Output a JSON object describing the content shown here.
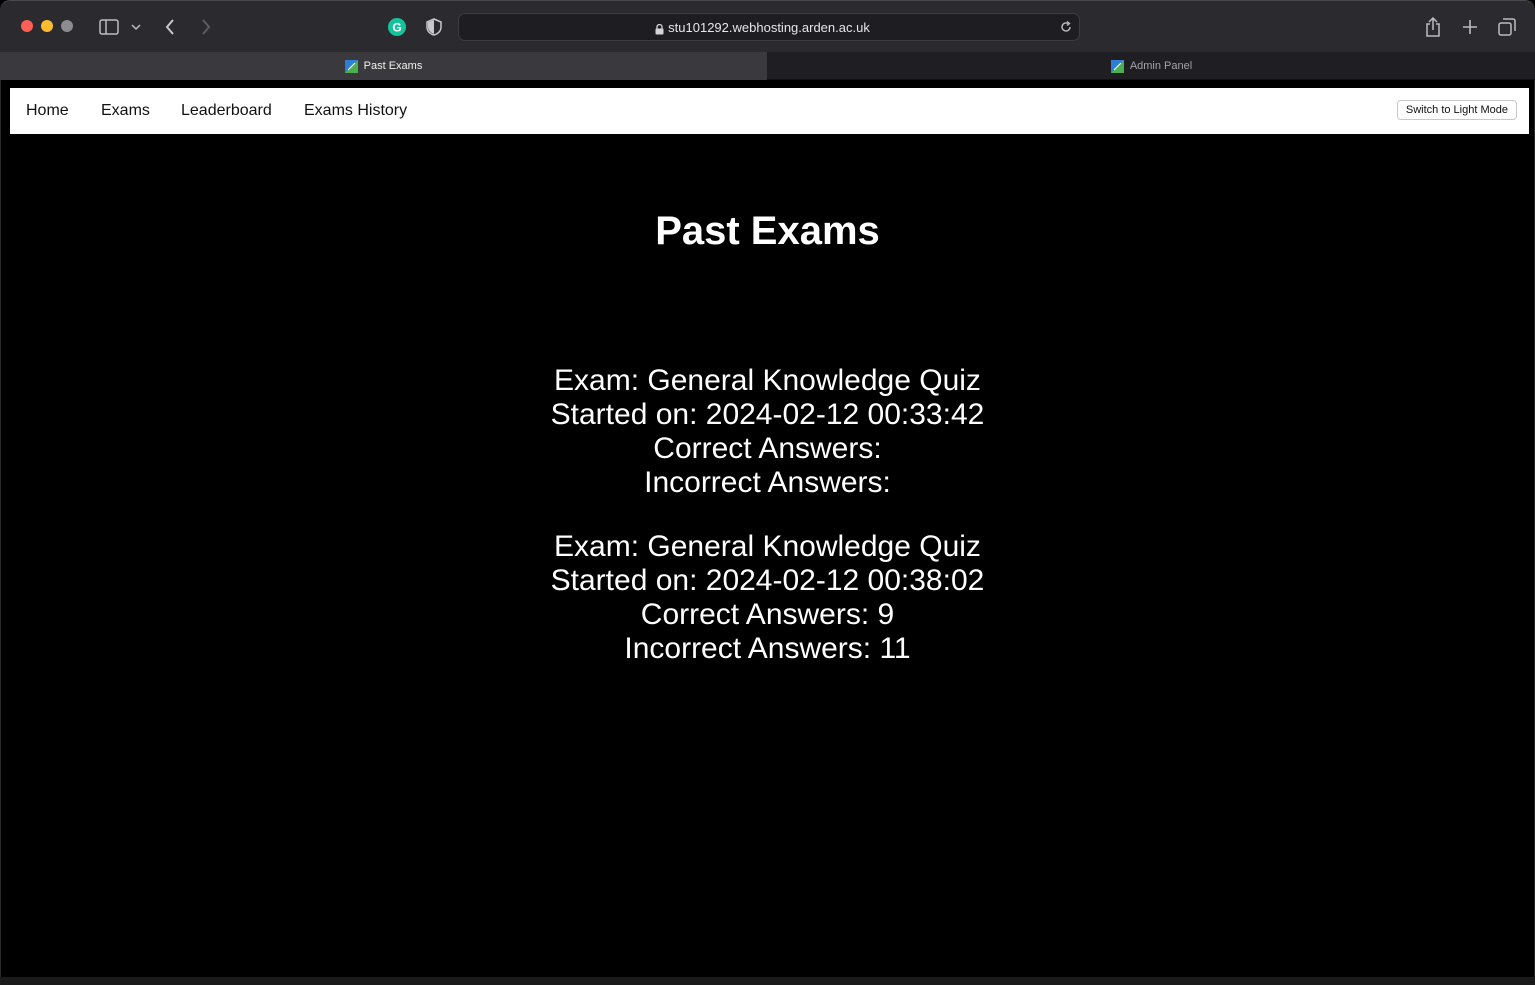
{
  "browser": {
    "url": "stu101292.webhosting.arden.ac.uk",
    "tabs": [
      {
        "label": "Past Exams",
        "active": true
      },
      {
        "label": "Admin Panel",
        "active": false
      }
    ]
  },
  "nav": {
    "links": [
      "Home",
      "Exams",
      "Leaderboard",
      "Exams History"
    ],
    "mode_button": "Switch to Light Mode"
  },
  "page": {
    "title": "Past Exams"
  },
  "exams": [
    {
      "exam": "Exam: General Knowledge Quiz",
      "started": "Started on: 2024-02-12 00:33:42",
      "correct": "Correct Answers:",
      "incorrect": "Incorrect Answers:"
    },
    {
      "exam": "Exam: General Knowledge Quiz",
      "started": "Started on: 2024-02-12 00:38:02",
      "correct": "Correct Answers: 9",
      "incorrect": "Incorrect Answers: 11"
    }
  ],
  "colors": {
    "background": "#000000",
    "navbar": "#ffffff",
    "text": "#ffffff"
  }
}
